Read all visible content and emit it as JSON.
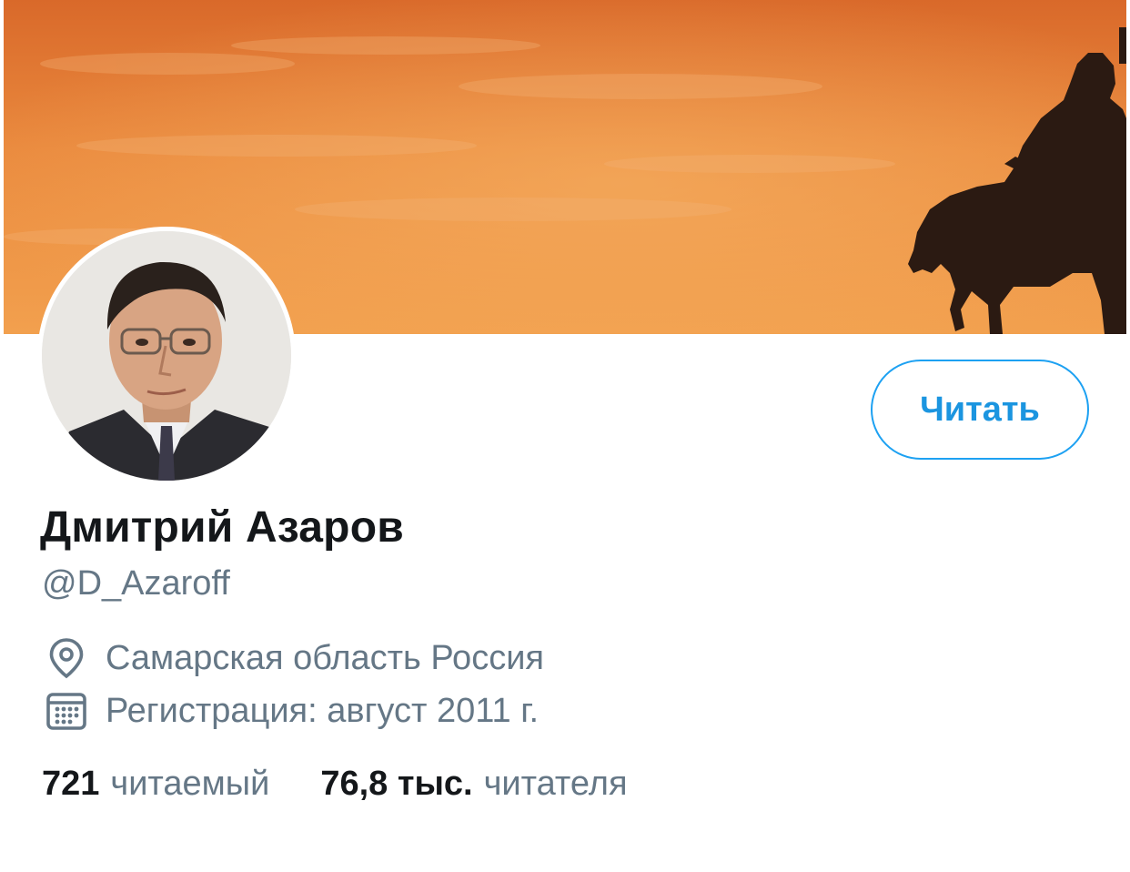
{
  "profile": {
    "display_name": "Дмитрий Азаров",
    "handle": "@D_Azaroff",
    "follow_label": "Читать",
    "location": "Самарская область Россия",
    "joined": "Регистрация: август 2011 г.",
    "following_count": "721",
    "following_label": "читаемый",
    "followers_count": "76,8 тыс.",
    "followers_label": "читателя"
  },
  "icons": {
    "location": "location-pin-icon",
    "calendar": "calendar-icon"
  },
  "colors": {
    "accent": "#1da1f2",
    "text_primary": "#14171a",
    "text_secondary": "#657786",
    "banner_sky": "#e8843a"
  }
}
